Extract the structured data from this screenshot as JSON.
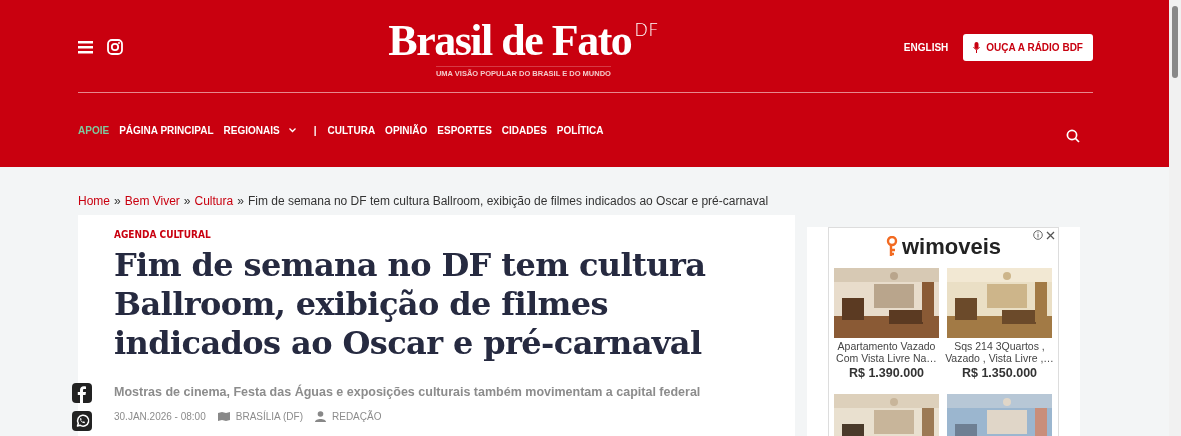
{
  "header": {
    "logo": {
      "name": "Brasil de Fato",
      "edition": "DF",
      "tagline": "UMA VISÃO POPULAR DO BRASIL E DO MUNDO"
    },
    "actions": [
      {
        "label": "ENGLISH",
        "kind": "link",
        "highlighted": false
      },
      {
        "label": "OUÇA A RÁDIO BDF",
        "kind": "radio",
        "highlighted": true
      }
    ],
    "nav": [
      {
        "label": "APOIE",
        "kind": "support"
      },
      {
        "label": "PÁGINA PRINCIPAL",
        "kind": "link"
      },
      {
        "label": "REGIONAIS",
        "kind": "dropdown"
      },
      {
        "label": "|",
        "kind": "separator"
      },
      {
        "label": "CULTURA",
        "kind": "link"
      },
      {
        "label": "OPINIÃO",
        "kind": "link"
      },
      {
        "label": "ESPORTES",
        "kind": "link"
      },
      {
        "label": "CIDADES",
        "kind": "link"
      },
      {
        "label": "POLÍTICA",
        "kind": "link"
      }
    ]
  },
  "breadcrumb": [
    {
      "label": "Home",
      "kind": "link"
    },
    {
      "label": "»",
      "kind": "separator"
    },
    {
      "label": "Bem Viver",
      "kind": "link"
    },
    {
      "label": "»",
      "kind": "separator"
    },
    {
      "label": "Cultura",
      "kind": "link"
    },
    {
      "label": "»",
      "kind": "separator"
    },
    {
      "label": "Fim de semana no DF tem cultura Ballroom, exibição de filmes indicados ao Oscar e pré-carnaval",
      "kind": "current"
    }
  ],
  "article": {
    "kicker": "AGENDA CULTURAL",
    "title": "Fim de semana no DF tem cultura Ballroom, exibição de filmes indicados ao Oscar e pré-carnaval",
    "subtitle": "Mostras de cinema, Festa das Águas e exposições culturais também movimentam a capital federal",
    "date": "30.JAN.2026 - 08:00",
    "location": "BRASÍLIA (DF)",
    "author": "REDAÇÃO"
  },
  "share": [
    {
      "kind": "facebook"
    },
    {
      "kind": "whatsapp"
    }
  ],
  "ad": {
    "brand": "wimoveis",
    "listings": [
      {
        "title": "Apartamento Vazado Com Vista Livre Na…",
        "price": "R$ 1.390.000",
        "kind": "picture"
      },
      {
        "title": "Sqs 214 3Quartos , Vazado , Vista Livre ,…",
        "price": "R$ 1.350.000",
        "kind": "picture"
      },
      {
        "kind": "picture"
      },
      {
        "kind": "picture"
      }
    ]
  }
}
